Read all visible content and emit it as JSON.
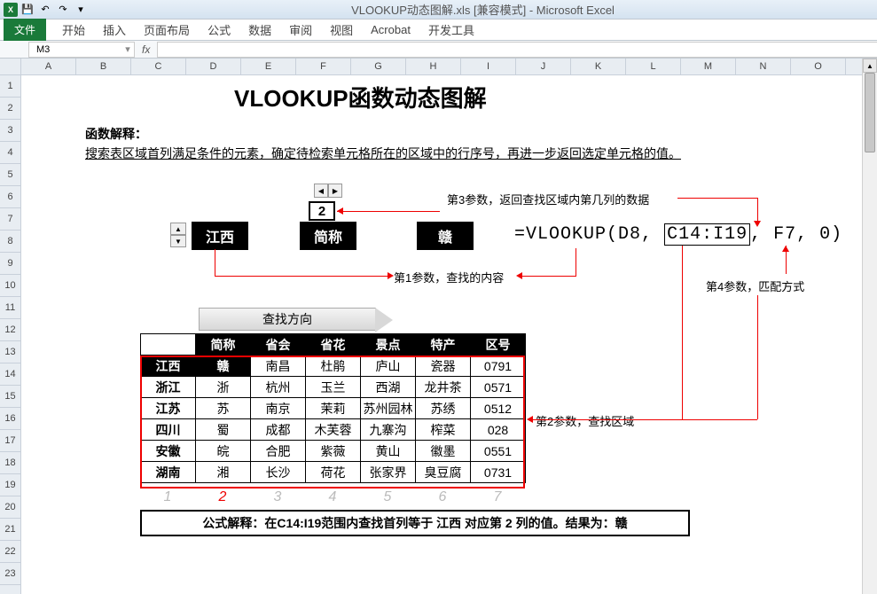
{
  "window": {
    "title": "VLOOKUP动态图解.xls  [兼容模式] - Microsoft Excel"
  },
  "ribbon": {
    "file": "文件",
    "tabs": [
      "开始",
      "插入",
      "页面布局",
      "公式",
      "数据",
      "审阅",
      "视图",
      "Acrobat",
      "开发工具"
    ]
  },
  "formula_bar": {
    "cell_ref": "M3",
    "fx": "fx",
    "formula": ""
  },
  "columns": [
    "A",
    "B",
    "C",
    "D",
    "E",
    "F",
    "G",
    "H",
    "I",
    "J",
    "K",
    "L",
    "M",
    "N",
    "O"
  ],
  "rows": [
    "1",
    "2",
    "3",
    "4",
    "5",
    "6",
    "7",
    "8",
    "9",
    "10",
    "11",
    "12",
    "13",
    "14",
    "15",
    "16",
    "17",
    "18",
    "19",
    "20",
    "21",
    "22",
    "23"
  ],
  "doc": {
    "title": "VLOOKUP函数动态图解",
    "func_label": "函数解释：",
    "func_desc": "搜索表区域首列满足条件的元素，确定待检索单元格所在的区域中的行序号，再进一步返回选定单元格的值。",
    "param1_value": "江西",
    "param2_label": "简称",
    "param2_num": "2",
    "param3_value": "赣",
    "formula_display": {
      "prefix": "=VLOOKUP(",
      "arg1": "D8",
      "sep1": ", ",
      "arg2": "C14:I19",
      "sep2": ", ",
      "arg3": "F7",
      "sep3": ", ",
      "arg4": "0",
      "suffix": ")"
    },
    "anno_p1": "第1参数，查找的内容",
    "anno_p2": "第2参数，查找区域",
    "anno_p3": "第3参数，返回查找区域内第几列的数据",
    "anno_p4": "第4参数，匹配方式",
    "direction": "查找方向",
    "table": {
      "headers": [
        "",
        "简称",
        "省会",
        "省花",
        "景点",
        "特产",
        "区号"
      ],
      "rows": [
        [
          "江西",
          "赣",
          "南昌",
          "杜鹃",
          "庐山",
          "瓷器",
          "0791"
        ],
        [
          "浙江",
          "浙",
          "杭州",
          "玉兰",
          "西湖",
          "龙井茶",
          "0571"
        ],
        [
          "江苏",
          "苏",
          "南京",
          "茉莉",
          "苏州园林",
          "苏绣",
          "0512"
        ],
        [
          "四川",
          "蜀",
          "成都",
          "木芙蓉",
          "九寨沟",
          "榨菜",
          "028"
        ],
        [
          "安徽",
          "皖",
          "合肥",
          "紫薇",
          "黄山",
          "徽墨",
          "0551"
        ],
        [
          "湖南",
          "湘",
          "长沙",
          "荷花",
          "张家界",
          "臭豆腐",
          "0731"
        ]
      ]
    },
    "col_nums": [
      "1",
      "2",
      "3",
      "4",
      "5",
      "6",
      "7"
    ],
    "active_col": 1,
    "explain": "公式解释：在C14:I19范围内查找首列等于  江西  对应第  2  列的值。结果为：赣"
  }
}
